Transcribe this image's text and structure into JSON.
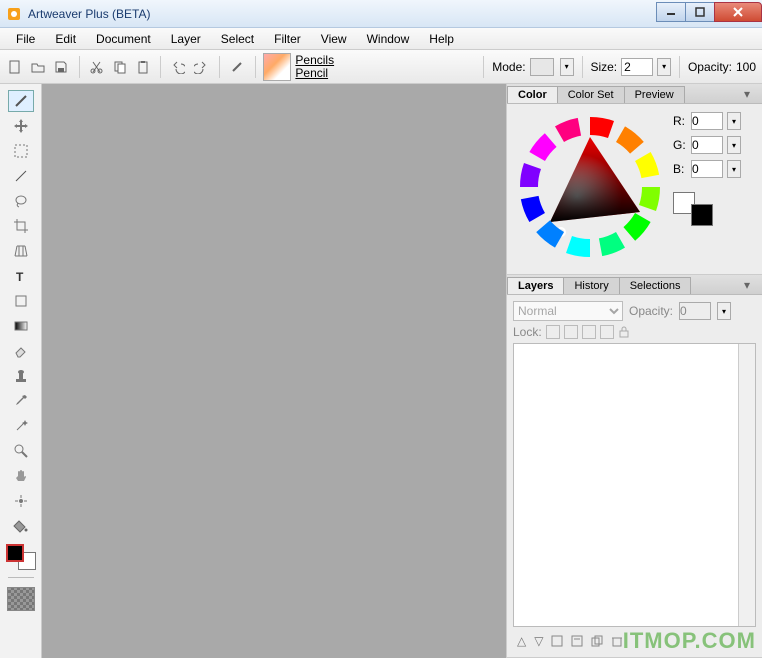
{
  "window": {
    "title": "Artweaver Plus (BETA)"
  },
  "menu": [
    "File",
    "Edit",
    "Document",
    "Layer",
    "Select",
    "Filter",
    "View",
    "Window",
    "Help"
  ],
  "toolbar": {
    "brush_category": "Pencils",
    "brush_variant": "Pencil",
    "mode_label": "Mode:",
    "size_label": "Size:",
    "size_value": "2",
    "opacity_label": "Opacity:",
    "opacity_value": "100"
  },
  "tools": [
    {
      "name": "brush",
      "selected": true
    },
    {
      "name": "move",
      "selected": false
    },
    {
      "name": "marquee",
      "selected": false
    },
    {
      "name": "line",
      "selected": false
    },
    {
      "name": "lasso",
      "selected": false
    },
    {
      "name": "crop",
      "selected": false
    },
    {
      "name": "perspective",
      "selected": false
    },
    {
      "name": "text",
      "selected": false
    },
    {
      "name": "shape",
      "selected": false
    },
    {
      "name": "gradient",
      "selected": false
    },
    {
      "name": "eraser",
      "selected": false
    },
    {
      "name": "stamp",
      "selected": false
    },
    {
      "name": "eyedropper",
      "selected": false
    },
    {
      "name": "wand",
      "selected": false
    },
    {
      "name": "zoom",
      "selected": false
    },
    {
      "name": "hand",
      "selected": false
    },
    {
      "name": "event",
      "selected": false
    },
    {
      "name": "fill",
      "selected": false
    }
  ],
  "color_panel": {
    "tabs": [
      "Color",
      "Color Set",
      "Preview"
    ],
    "active_tab": "Color",
    "channels": [
      {
        "label": "R:",
        "value": "0"
      },
      {
        "label": "G:",
        "value": "0"
      },
      {
        "label": "B:",
        "value": "0"
      }
    ],
    "foreground": "#000000",
    "background": "#ffffff"
  },
  "layers_panel": {
    "tabs": [
      "Layers",
      "History",
      "Selections"
    ],
    "active_tab": "Layers",
    "blend_mode": "Normal",
    "opacity_label": "Opacity:",
    "opacity_value": "0",
    "lock_label": "Lock:"
  },
  "watermark": "ITMOP.COM"
}
